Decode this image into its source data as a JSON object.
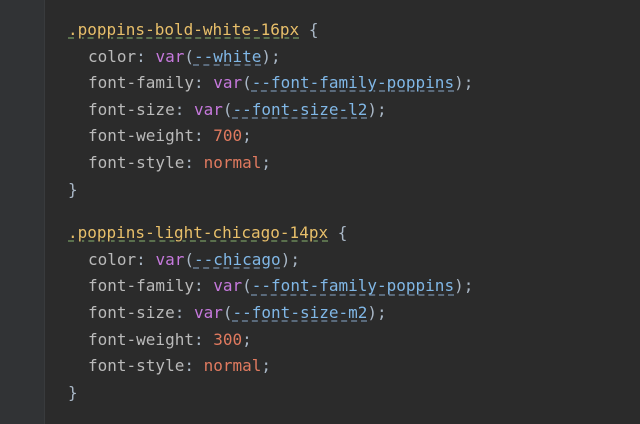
{
  "rules": [
    {
      "selector": ".poppins-bold-white-16px",
      "open": " {",
      "close": "}",
      "decls": {
        "color": {
          "prop": "color",
          "func": "var",
          "var": "--white"
        },
        "family": {
          "prop": "font-family",
          "func": "var",
          "var": "--font-family-poppins"
        },
        "size": {
          "prop": "font-size",
          "func": "var",
          "var": "--font-size-l2"
        },
        "weight": {
          "prop": "font-weight",
          "value": "700"
        },
        "style": {
          "prop": "font-style",
          "value": "normal"
        }
      }
    },
    {
      "selector": ".poppins-light-chicago-14px",
      "open": " {",
      "close": "}",
      "decls": {
        "color": {
          "prop": "color",
          "func": "var",
          "var": "--chicago"
        },
        "family": {
          "prop": "font-family",
          "func": "var",
          "var": "--font-family-poppins"
        },
        "size": {
          "prop": "font-size",
          "func": "var",
          "var": "--font-size-m2"
        },
        "weight": {
          "prop": "font-weight",
          "value": "300"
        },
        "style": {
          "prop": "font-style",
          "value": "normal"
        }
      }
    }
  ],
  "punct": {
    "colon": ": ",
    "open_paren": "(",
    "close_paren_semi": ");",
    "semi": ";"
  },
  "colors": {
    "background": "#2b2b2b",
    "gutter": "#313335",
    "selector": "#e8bf6a",
    "property": "#bababa",
    "function": "#c679dd",
    "variable": "#80b7e6",
    "number": "#e07a5f"
  }
}
